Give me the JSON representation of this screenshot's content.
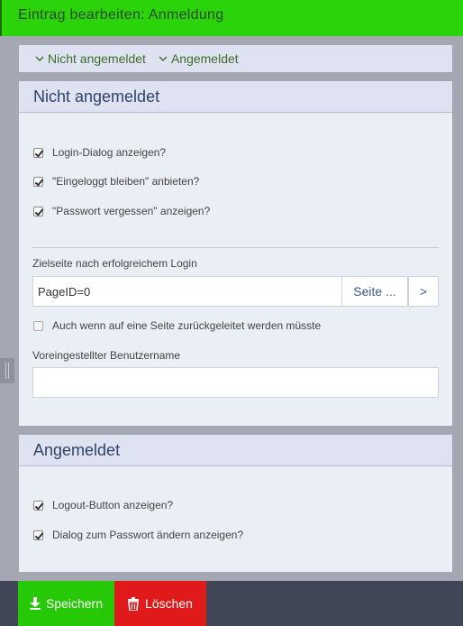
{
  "header": {
    "title": "Eintrag bearbeiten: Anmeldung"
  },
  "anchors": [
    {
      "label": "Nicht angemeldet"
    },
    {
      "label": "Angemeldet"
    }
  ],
  "section_logged_out": {
    "title": "Nicht angemeldet",
    "checkboxes": [
      {
        "label": "Login-Dialog anzeigen?",
        "checked": true
      },
      {
        "label": "\"Eingeloggt bleiben\" anbieten?",
        "checked": true
      },
      {
        "label": "\"Passwort vergessen\" anzeigen?",
        "checked": true
      }
    ],
    "target_label": "Zielseite nach erfolgreichem Login",
    "target_value": "PageID=0",
    "page_button": "Seite ...",
    "go_button": ">",
    "redirect_checkbox": {
      "label": "Auch wenn auf eine Seite zurückgeleitet werden müsste",
      "checked": false
    },
    "username_label": "Voreingestellter Benutzername",
    "username_value": ""
  },
  "section_logged_in": {
    "title": "Angemeldet",
    "checkboxes": [
      {
        "label": "Logout-Button anzeigen?",
        "checked": true
      },
      {
        "label": "Dialog zum Passwort ändern anzeigen?",
        "checked": true
      }
    ]
  },
  "footer": {
    "save_label": "Speichern",
    "delete_label": "Löschen"
  },
  "colors": {
    "header_green": "#2bd40a",
    "save_green": "#27c906",
    "delete_red": "#e01a1a",
    "footer_bg": "#404656",
    "page_bg": "#a5a8b3"
  },
  "icons": [
    "chevron-down-icon",
    "download-icon",
    "trash-icon"
  ]
}
